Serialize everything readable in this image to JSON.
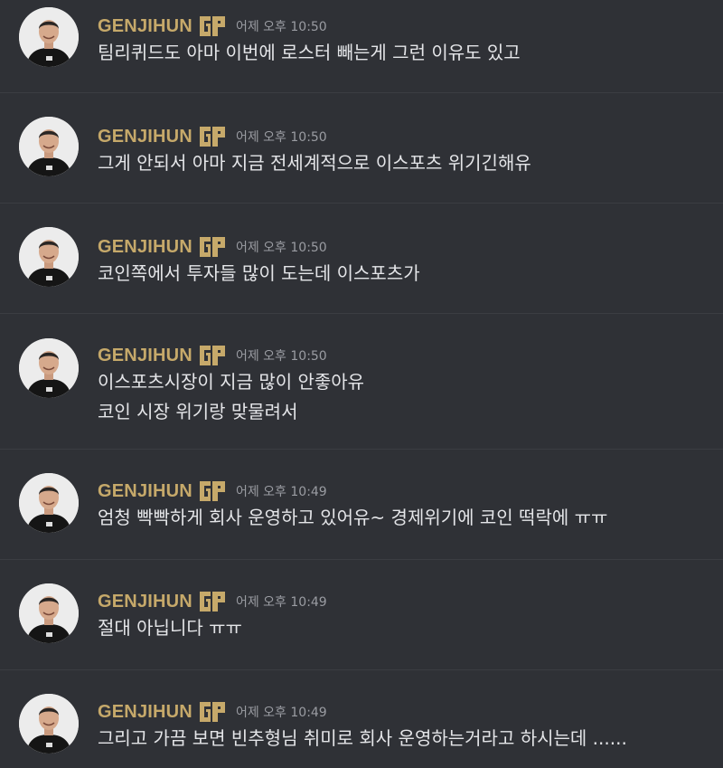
{
  "channel": {
    "messages": [
      {
        "username": "GENJIHUN",
        "badge_icon": "gen-g-logo-icon",
        "timestamp": "어제 오후 10:50",
        "lines": [
          "팀리퀴드도 아마 이번에 로스터 빼는게 그런 이유도 있고"
        ]
      },
      {
        "username": "GENJIHUN",
        "badge_icon": "gen-g-logo-icon",
        "timestamp": "어제 오후 10:50",
        "lines": [
          "그게 안되서 아마 지금 전세계적으로 이스포츠 위기긴해유"
        ]
      },
      {
        "username": "GENJIHUN",
        "badge_icon": "gen-g-logo-icon",
        "timestamp": "어제 오후 10:50",
        "lines": [
          "코인쪽에서 투자들 많이 도는데 이스포츠가"
        ]
      },
      {
        "username": "GENJIHUN",
        "badge_icon": "gen-g-logo-icon",
        "timestamp": "어제 오후 10:50",
        "lines": [
          "이스포츠시장이 지금 많이 안좋아유",
          "코인 시장 위기랑 맞물려서"
        ]
      },
      {
        "username": "GENJIHUN",
        "badge_icon": "gen-g-logo-icon",
        "timestamp": "어제 오후 10:49",
        "lines": [
          "엄청 빡빡하게 회사 운영하고 있어유~ 경제위기에 코인 떡락에 ㅠㅠ"
        ]
      },
      {
        "username": "GENJIHUN",
        "badge_icon": "gen-g-logo-icon",
        "timestamp": "어제 오후 10:49",
        "lines": [
          "절대 아닙니다 ㅠㅠ"
        ]
      },
      {
        "username": "GENJIHUN",
        "badge_icon": "gen-g-logo-icon",
        "timestamp": "어제 오후 10:49",
        "lines": [
          "그리고 가끔 보면 빈추형님 취미로 회사 운영하는거라고 하시는데 ......"
        ]
      }
    ]
  },
  "colors": {
    "background": "#2f3136",
    "username": "#c6a96a",
    "timestamp": "#9a9ca2",
    "message_text": "#e4e5e8",
    "divider": "#3b3d42"
  }
}
